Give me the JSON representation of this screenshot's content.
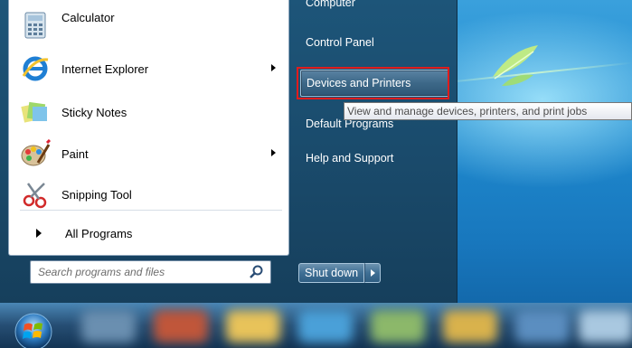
{
  "programs": [
    {
      "label": "Calculator",
      "icon": "calculator-icon",
      "has_submenu": false
    },
    {
      "label": "Internet Explorer",
      "icon": "internet-explorer-icon",
      "has_submenu": true
    },
    {
      "label": "Sticky Notes",
      "icon": "sticky-notes-icon",
      "has_submenu": false
    },
    {
      "label": "Paint",
      "icon": "paint-icon",
      "has_submenu": true
    },
    {
      "label": "Snipping Tool",
      "icon": "snipping-tool-icon",
      "has_submenu": false
    }
  ],
  "all_programs_label": "All Programs",
  "search": {
    "placeholder": "Search programs and files"
  },
  "right_pane": {
    "cut_item": "Computer",
    "control_panel": "Control Panel",
    "devices_and_printers": "Devices and Printers",
    "default_programs": "Default Programs",
    "help_and_support": "Help and Support"
  },
  "tooltip": "View and manage devices, printers, and print jobs",
  "shutdown_label": "Shut down",
  "colors": {
    "highlight_border": "#e01c1c",
    "menu_background": "#1a4b6c",
    "tooltip_text": "#4c4c4c"
  }
}
